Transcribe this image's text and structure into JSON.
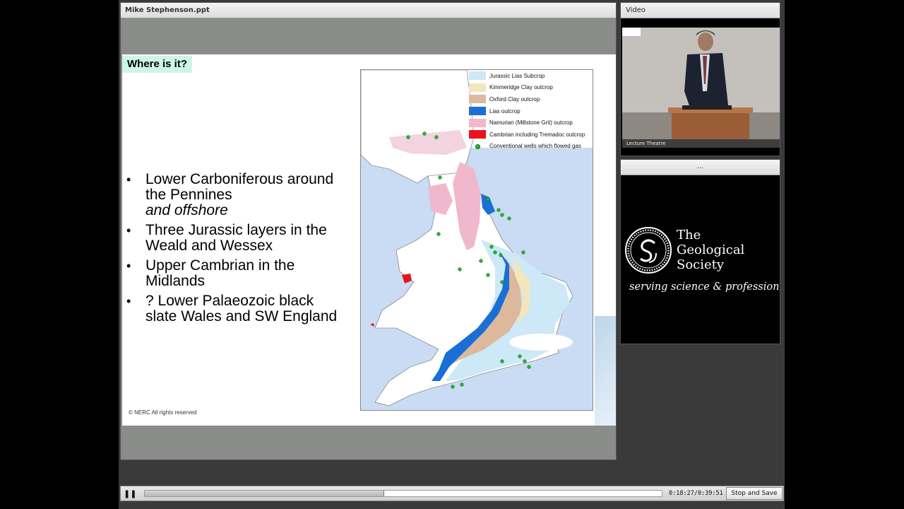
{
  "slide_panel": {
    "title": "Mike Stephenson.ppt"
  },
  "slide": {
    "title": "Where is it?",
    "bullets": [
      {
        "text": "Lower Carboniferous around the Pennines",
        "emphasis": "and offshore"
      },
      {
        "text": "Three Jurassic layers in the Weald and Wessex"
      },
      {
        "text": "Upper Cambrian in the Midlands"
      },
      {
        "text": "? Lower Palaeozoic black slate Wales and SW England"
      }
    ],
    "copyright": "© NERC All rights reserved",
    "legend": [
      {
        "label": "Jurassic Lias Subcrop",
        "color": "#cde8f7"
      },
      {
        "label": "Kimmeridge Clay outcrop",
        "color": "#f3e6bd"
      },
      {
        "label": "Oxford Clay outcrop",
        "color": "#dcb99c"
      },
      {
        "label": "Lias outcrop",
        "color": "#1a6fd6"
      },
      {
        "label": "Namurian (Millstone Grit) outcrop",
        "color": "#f0b8cc"
      },
      {
        "label": "Cambrian including Tremadoc outcrop",
        "color": "#e8141a"
      },
      {
        "label": "Conventional wells which flowed gas",
        "color": "#1fbf2a"
      }
    ]
  },
  "video_panel": {
    "title": "Video",
    "caption": "Lecture  Theatre"
  },
  "logo_panel": {
    "title": "...",
    "name_lines": [
      "The",
      "Geological",
      "Society"
    ],
    "tagline": "serving science & profession"
  },
  "controls": {
    "time": "0:18:27/0:39:51",
    "progress": 0.463,
    "stop_label": "Stop and Save",
    "pause_icon": "pause-icon"
  }
}
